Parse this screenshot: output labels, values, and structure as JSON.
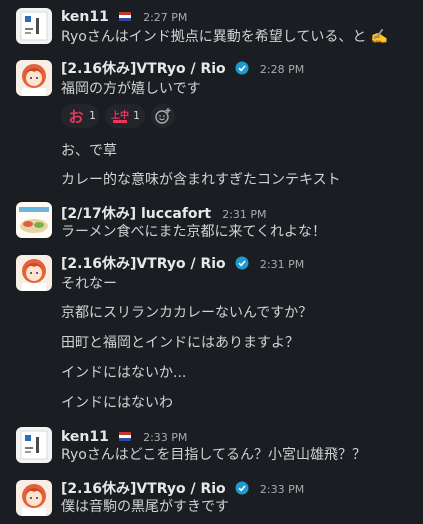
{
  "messages": [
    {
      "author": "ken11",
      "time": "2:27 PM",
      "lines": [
        "Ryoさんはインド拠点に異動を希望している、と ✍️"
      ]
    },
    {
      "author": "[2.16休み]VTRyo / Rio",
      "time": "2:28 PM",
      "lines": [
        "福岡の方が嬉しいです"
      ],
      "reactions": [
        {
          "emoji": "o-stamp-icon",
          "glyph": "お",
          "count": "1"
        },
        {
          "emoji": "upper-chu-stamp-icon",
          "glyph": "上中",
          "count": "1"
        }
      ],
      "extra_lines": [
        "お、で草",
        "カレー的な意味が含まれすぎたコンテキスト"
      ]
    },
    {
      "author": "[2/17休み] luccafort",
      "time": "2:31 PM",
      "lines": [
        "ラーメン食べにまた京都に来てくれよな！"
      ]
    },
    {
      "author": "[2.16休み]VTRyo / Rio",
      "time": "2:31 PM",
      "lines": [
        "それなー",
        "京都にスリランカカレーないんですか？",
        "田町と福岡とインドにはありますよ？",
        "インドにはないか...",
        "インドにはないわ"
      ]
    },
    {
      "author": "ken11",
      "time": "2:33 PM",
      "lines": [
        "Ryoさんはどこを目指してるん？小宮山雄飛？？"
      ]
    },
    {
      "author": "[2.16休み]VTRyo / Rio",
      "time": "2:33 PM",
      "lines": [
        "僕は音駒の黒尾がすきです"
      ]
    }
  ],
  "colors": {
    "background": "#1a1d21",
    "text": "#d1d2d3",
    "timestamp": "#ababad",
    "verified": "#1d9bd1",
    "reaction_bg": "#222529"
  }
}
